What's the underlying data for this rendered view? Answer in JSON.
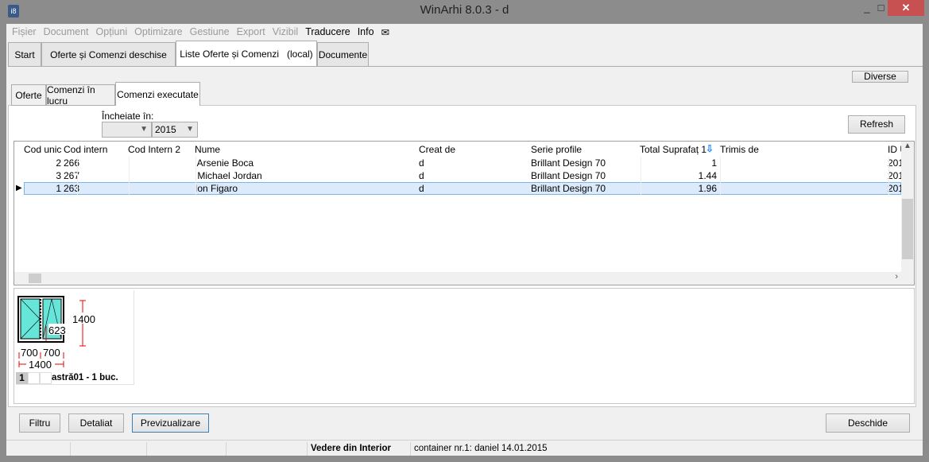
{
  "window": {
    "title": "WinArhi 8.0.3 - d",
    "minimize": "_",
    "maximize": "□",
    "close": "✕"
  },
  "menu": [
    {
      "label": "Fișier",
      "enabled": false
    },
    {
      "label": "Document",
      "enabled": false
    },
    {
      "label": "Opțiuni",
      "enabled": false
    },
    {
      "label": "Optimizare",
      "enabled": false
    },
    {
      "label": "Gestiune",
      "enabled": false
    },
    {
      "label": "Export",
      "enabled": false
    },
    {
      "label": "Vizibil",
      "enabled": false
    },
    {
      "label": "Traducere",
      "enabled": true
    },
    {
      "label": "Info",
      "enabled": true
    }
  ],
  "mail_icon": "envelope-icon",
  "top_tabs": [
    "Start",
    "Oferte și Comenzi deschise",
    "Liste Oferte și Comenzi   (local)",
    "Documente"
  ],
  "top_tab_selected": 2,
  "diverse_label": "Diverse",
  "sub_tabs": [
    "Oferte",
    "Comenzi în lucru",
    "Comenzi executate"
  ],
  "sub_tab_selected": 2,
  "filter": {
    "label": "Încheiate în:",
    "month": "",
    "year": "2015"
  },
  "refresh_label": "Refresh",
  "grid": {
    "columns": [
      "Cod unic",
      "Cod intern",
      "Cod Intern 2",
      "Nume",
      "Creat de",
      "Serie profile",
      "Total Suprafaț 1",
      "Trimis de",
      "ID U"
    ],
    "sort_icon": "sort-down-arrow-icon",
    "rows": [
      [
        "2",
        "266",
        "",
        " Arsenie Boca",
        "d",
        "Brillant Design 70",
        "1",
        "",
        "201"
      ],
      [
        "3",
        "267",
        "",
        " Michael Jordan",
        "d",
        "Brillant Design 70",
        "1.44",
        "",
        "201"
      ],
      [
        "1",
        "263",
        "",
        "Ion Figaro",
        "d",
        "Brillant Design 70",
        "1.96",
        "",
        "201"
      ]
    ],
    "selected_row": 2
  },
  "preview": {
    "height": "1400",
    "width": "1400",
    "sash1": "700",
    "sash2": "700",
    "handle": "623",
    "page": "1",
    "caption": "astră01 - 1 buc."
  },
  "buttons": {
    "filter": "Filtru",
    "detail": "Detaliat",
    "preview": "Previzualizare",
    "open": "Deschide"
  },
  "status": {
    "view": "Vedere din Interior",
    "info": "container nr.1: daniel 14.01.2015"
  }
}
